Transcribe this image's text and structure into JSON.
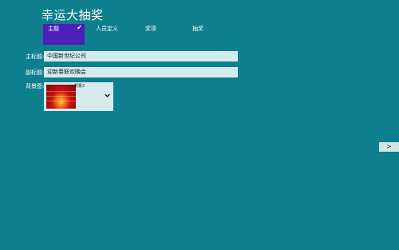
{
  "app": {
    "title": "幸运大抽奖"
  },
  "tabs": [
    {
      "label": "主题",
      "active": true
    },
    {
      "label": "人员定义",
      "active": false
    },
    {
      "label": "奖项",
      "active": false
    },
    {
      "label": "抽奖",
      "active": false
    }
  ],
  "form": {
    "main_title_label": "主标题:",
    "main_title_value": "中国新世纪公司",
    "sub_title_label": "副标题:",
    "sub_title_value": "迎新春联欢晚会",
    "background_label": "背景图:",
    "background_value": "背景2"
  },
  "icons": {
    "check": "checkmark-icon",
    "dropdown": "chevron-down-icon",
    "next": "chevron-right-icon"
  },
  "next_button": {
    "label": ">"
  },
  "colors": {
    "background": "#0e7f8f",
    "active_tab": "#4b1fb8",
    "field": "#d6ebee"
  }
}
